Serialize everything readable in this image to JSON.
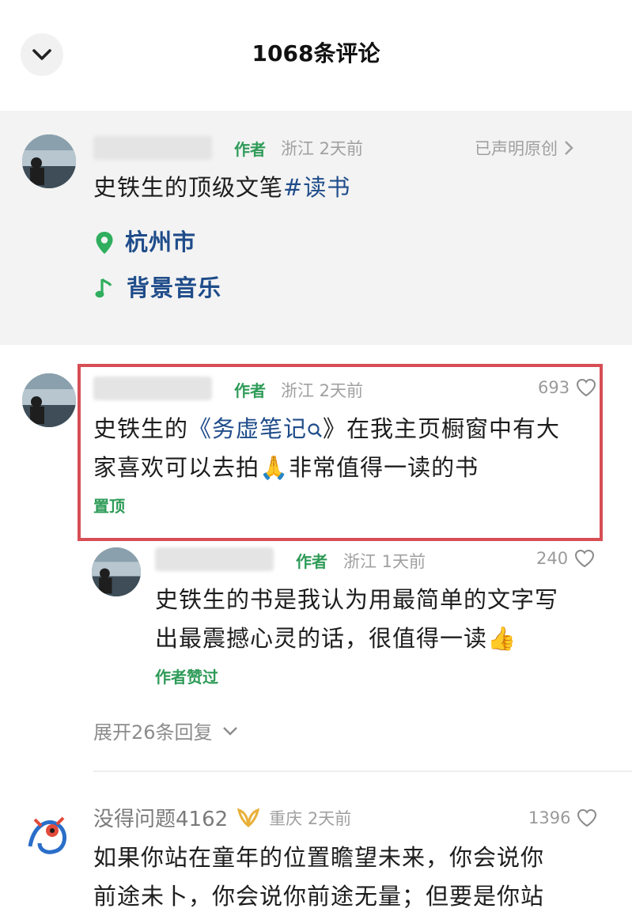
{
  "header": {
    "title": "1068条评论"
  },
  "post": {
    "author_tag": "作者",
    "location_time": "浙江 2天前",
    "original_label": "已声明原创",
    "text_before": "史铁生的顶级文笔",
    "hashtag": "#读书",
    "location": "杭州市",
    "music": "背景音乐"
  },
  "comments": [
    {
      "author_tag": "作者",
      "location_time": "浙江 2天前",
      "likes": "693",
      "text_line1_prefix": "史铁生的",
      "book_link": "《务虚笔记",
      "text_line1_suffix": "》在我主页橱窗中有大",
      "text_line2_prefix": "家喜欢可以去拍",
      "emoji": "🙏",
      "text_line2_suffix": "非常值得一读的书",
      "pinned_label": "置顶"
    },
    {
      "author_tag": "作者",
      "location_time": "浙江 1天前",
      "likes": "240",
      "text_line1": "史铁生的书是我认为用最简单的文字写",
      "text_line2_prefix": "出最震撼心灵的话，很值得一读",
      "emoji": "👍",
      "liked_label": "作者赞过"
    }
  ],
  "expand_replies": "展开26条回复",
  "comment3": {
    "username": "没得问题4162",
    "location_time": "重庆 2天前",
    "likes": "1396",
    "text_line1": "如果你站在童年的位置瞻望未来，你会说你",
    "text_line2": "前途未卜，你会说你前途无量；但要是你站"
  },
  "colors": {
    "author_green": "#2e9b58",
    "highlight_red": "#d74e55",
    "link_blue": "#1f4c8a"
  }
}
